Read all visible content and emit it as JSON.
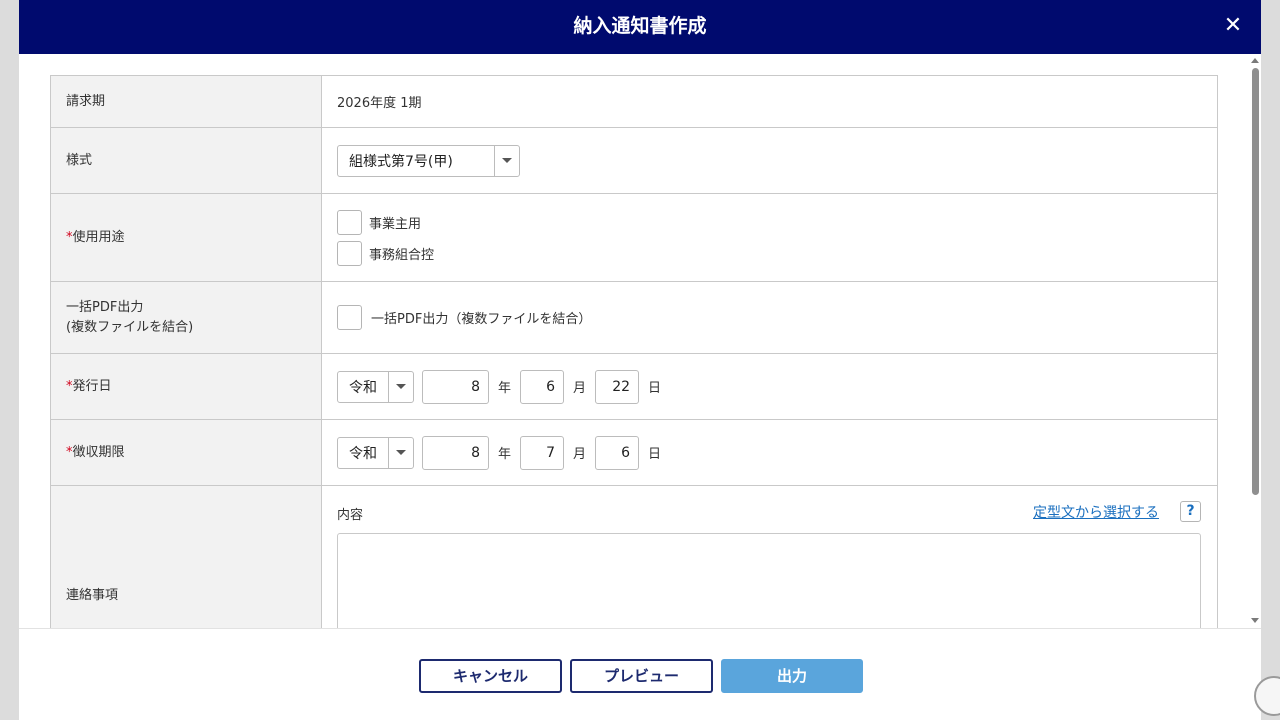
{
  "modal": {
    "title": "納入通知書作成",
    "close_icon": "close-icon",
    "close_glyph": "✕"
  },
  "form": {
    "billing_period": {
      "label": "請求期",
      "value": "2026年度 1期"
    },
    "format": {
      "label": "様式",
      "selected": "組様式第7号(甲)"
    },
    "usage": {
      "required_mark": "*",
      "label": "使用用途",
      "options": [
        {
          "label": "事業主用",
          "checked": false
        },
        {
          "label": "事務組合控",
          "checked": false
        }
      ]
    },
    "bulk_pdf": {
      "label_line1": "一括PDF出力",
      "label_line2": "(複数ファイルを結合)",
      "checkbox_label": "一括PDF出力（複数ファイルを結合）",
      "checked": false
    },
    "issue_date": {
      "required_mark": "*",
      "label": "発行日",
      "era": "令和",
      "year": "8",
      "year_unit": "年",
      "month": "6",
      "month_unit": "月",
      "day": "22",
      "day_unit": "日"
    },
    "due_date": {
      "required_mark": "*",
      "label": "徴収期限",
      "era": "令和",
      "year": "8",
      "year_unit": "年",
      "month": "7",
      "month_unit": "月",
      "day": "6",
      "day_unit": "日"
    },
    "notes": {
      "label": "連絡事項",
      "content_label": "内容",
      "template_link": "定型文から選択する",
      "help": "?",
      "value": ""
    }
  },
  "footer": {
    "cancel": "キャンセル",
    "preview": "プレビュー",
    "output": "出力"
  },
  "colors": {
    "header_bg": "#000a6e",
    "primary_button": "#5aa5dc",
    "outline_button": "#1d2a6f",
    "required": "#d0021b",
    "link": "#1a6fbf"
  }
}
